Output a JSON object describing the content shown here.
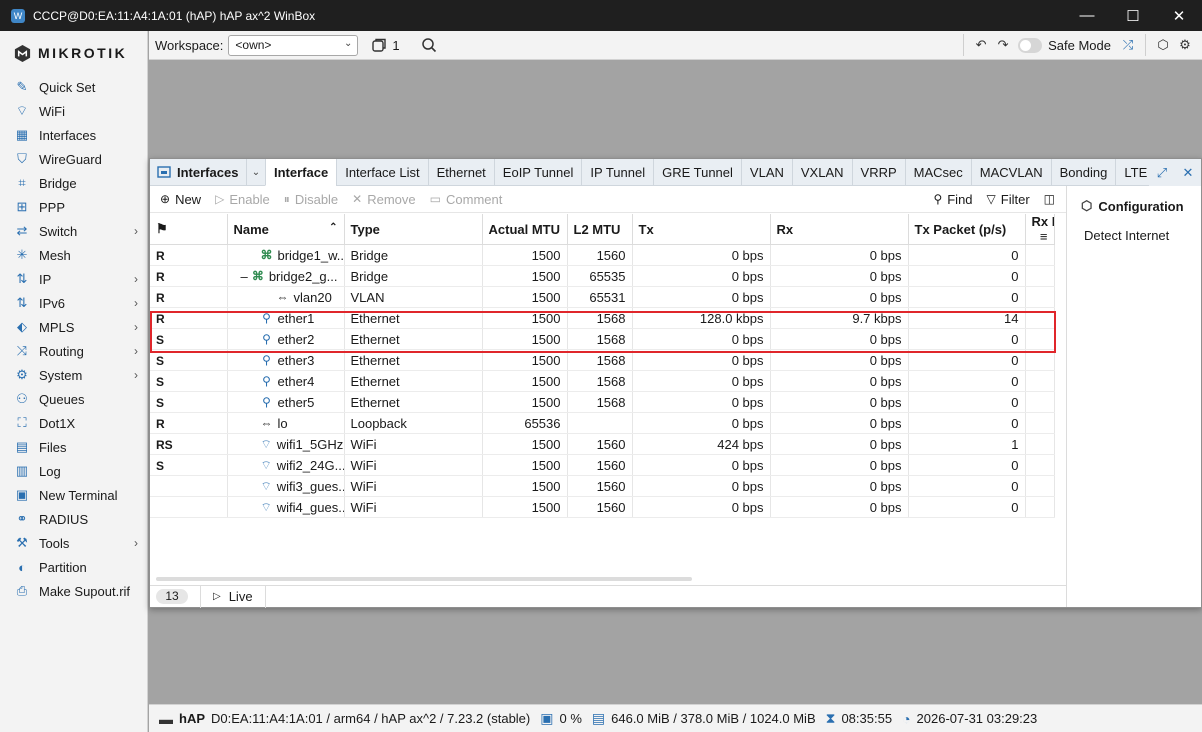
{
  "window": {
    "title": "CCCP@D0:EA:11:A4:1A:01 (hAP) hAP ax^2 WinBox"
  },
  "brand": "MIKROTIK",
  "sidebar": {
    "items": [
      {
        "label": "Quick Set",
        "icon": "quick-set-icon",
        "chev": ""
      },
      {
        "label": "WiFi",
        "icon": "wifi-icon",
        "chev": ""
      },
      {
        "label": "Interfaces",
        "icon": "interfaces-icon",
        "chev": ""
      },
      {
        "label": "WireGuard",
        "icon": "wireguard-icon",
        "chev": ""
      },
      {
        "label": "Bridge",
        "icon": "bridge-icon",
        "chev": ""
      },
      {
        "label": "PPP",
        "icon": "ppp-icon",
        "chev": ""
      },
      {
        "label": "Switch",
        "icon": "switch-icon",
        "chev": "›"
      },
      {
        "label": "Mesh",
        "icon": "mesh-icon",
        "chev": ""
      },
      {
        "label": "IP",
        "icon": "ip-icon",
        "chev": "›"
      },
      {
        "label": "IPv6",
        "icon": "ipv6-icon",
        "chev": "›"
      },
      {
        "label": "MPLS",
        "icon": "mpls-icon",
        "chev": "›"
      },
      {
        "label": "Routing",
        "icon": "routing-icon",
        "chev": "›"
      },
      {
        "label": "System",
        "icon": "system-icon",
        "chev": "›"
      },
      {
        "label": "Queues",
        "icon": "queues-icon",
        "chev": ""
      },
      {
        "label": "Dot1X",
        "icon": "dot1x-icon",
        "chev": ""
      },
      {
        "label": "Files",
        "icon": "files-icon",
        "chev": ""
      },
      {
        "label": "Log",
        "icon": "log-icon",
        "chev": ""
      },
      {
        "label": "New Terminal",
        "icon": "terminal-icon",
        "chev": ""
      },
      {
        "label": "RADIUS",
        "icon": "radius-icon",
        "chev": ""
      },
      {
        "label": "Tools",
        "icon": "tools-icon",
        "chev": "›"
      },
      {
        "label": "Partition",
        "icon": "partition-icon",
        "chev": ""
      },
      {
        "label": "Make Supout.rif",
        "icon": "supout-icon",
        "chev": ""
      }
    ]
  },
  "topbar": {
    "workspace_label": "Workspace:",
    "workspace_value": "<own>",
    "window_count": "1",
    "safe_mode": "Safe Mode"
  },
  "panel": {
    "title": "Interfaces",
    "tabs": [
      "Interface",
      "Interface List",
      "Ethernet",
      "EoIP Tunnel",
      "IP Tunnel",
      "GRE Tunnel",
      "VLAN",
      "VXLAN",
      "VRRP",
      "MACsec",
      "MACVLAN",
      "Bonding",
      "LTE"
    ],
    "toolbar": {
      "new": "New",
      "enable": "Enable",
      "disable": "Disable",
      "remove": "Remove",
      "comment": "Comment",
      "find": "Find",
      "filter": "Filter"
    },
    "columns": [
      "",
      "Name",
      "Type",
      "Actual MTU",
      "L2 MTU",
      "Tx",
      "Rx",
      "Tx Packet (p/s)",
      "Rx P"
    ],
    "rows": [
      {
        "flag": "R",
        "indent": 0,
        "expander": "",
        "icon": "bridge",
        "name": "bridge1_w...",
        "type": "Bridge",
        "mtu": "1500",
        "l2mtu": "1560",
        "tx": "0 bps",
        "rx": "0 bps",
        "txp": "0"
      },
      {
        "flag": "R",
        "indent": 0,
        "expander": "–",
        "icon": "bridge",
        "name": "bridge2_g...",
        "type": "Bridge",
        "mtu": "1500",
        "l2mtu": "65535",
        "tx": "0 bps",
        "rx": "0 bps",
        "txp": "0"
      },
      {
        "flag": "R",
        "indent": 1,
        "expander": "",
        "icon": "link",
        "name": "vlan20",
        "type": "VLAN",
        "mtu": "1500",
        "l2mtu": "65531",
        "tx": "0 bps",
        "rx": "0 bps",
        "txp": "0"
      },
      {
        "flag": "R",
        "indent": 0,
        "expander": "",
        "icon": "eth",
        "name": "ether1",
        "type": "Ethernet",
        "mtu": "1500",
        "l2mtu": "1568",
        "tx": "128.0 kbps",
        "rx": "9.7 kbps",
        "txp": "14"
      },
      {
        "flag": "S",
        "indent": 0,
        "expander": "",
        "icon": "eth",
        "name": "ether2",
        "type": "Ethernet",
        "mtu": "1500",
        "l2mtu": "1568",
        "tx": "0 bps",
        "rx": "0 bps",
        "txp": "0"
      },
      {
        "flag": "S",
        "indent": 0,
        "expander": "",
        "icon": "eth",
        "name": "ether3",
        "type": "Ethernet",
        "mtu": "1500",
        "l2mtu": "1568",
        "tx": "0 bps",
        "rx": "0 bps",
        "txp": "0"
      },
      {
        "flag": "S",
        "indent": 0,
        "expander": "",
        "icon": "eth",
        "name": "ether4",
        "type": "Ethernet",
        "mtu": "1500",
        "l2mtu": "1568",
        "tx": "0 bps",
        "rx": "0 bps",
        "txp": "0"
      },
      {
        "flag": "S",
        "indent": 0,
        "expander": "",
        "icon": "eth",
        "name": "ether5",
        "type": "Ethernet",
        "mtu": "1500",
        "l2mtu": "1568",
        "tx": "0 bps",
        "rx": "0 bps",
        "txp": "0"
      },
      {
        "flag": "R",
        "indent": 0,
        "expander": "",
        "icon": "link",
        "name": "lo",
        "type": "Loopback",
        "mtu": "65536",
        "l2mtu": "",
        "tx": "0 bps",
        "rx": "0 bps",
        "txp": "0"
      },
      {
        "flag": "RS",
        "indent": 0,
        "expander": "",
        "icon": "wifi",
        "name": "wifi1_5GHz",
        "type": "WiFi",
        "mtu": "1500",
        "l2mtu": "1560",
        "tx": "424 bps",
        "rx": "0 bps",
        "txp": "1"
      },
      {
        "flag": "S",
        "indent": 0,
        "expander": "",
        "icon": "wifi",
        "name": "wifi2_24G...",
        "type": "WiFi",
        "mtu": "1500",
        "l2mtu": "1560",
        "tx": "0 bps",
        "rx": "0 bps",
        "txp": "0"
      },
      {
        "flag": "",
        "indent": 0,
        "expander": "",
        "icon": "wifi",
        "name": "wifi3_gues...",
        "type": "WiFi",
        "mtu": "1500",
        "l2mtu": "1560",
        "tx": "0 bps",
        "rx": "0 bps",
        "txp": "0"
      },
      {
        "flag": "",
        "indent": 0,
        "expander": "",
        "icon": "wifi",
        "name": "wifi4_gues...",
        "type": "WiFi",
        "mtu": "1500",
        "l2mtu": "1560",
        "tx": "0 bps",
        "rx": "0 bps",
        "txp": "0"
      }
    ],
    "count": "13",
    "live": "Live",
    "side": {
      "configuration": "Configuration",
      "detect": "Detect Internet"
    }
  },
  "statusbar": {
    "device": "hAP",
    "info": "D0:EA:11:A4:1A:01 / arm64 / hAP ax^2 / 7.23.2 (stable)",
    "cpu": "0 %",
    "memory": "646.0 MiB / 378.0 MiB / 1024.0 MiB",
    "uptime": "08:35:55",
    "datetime": "2026-07-31 03:29:23"
  },
  "colors": {
    "accent": "#2a6fb0",
    "highlight": "#e0262b",
    "bridge_icon": "#2e8a4f"
  }
}
